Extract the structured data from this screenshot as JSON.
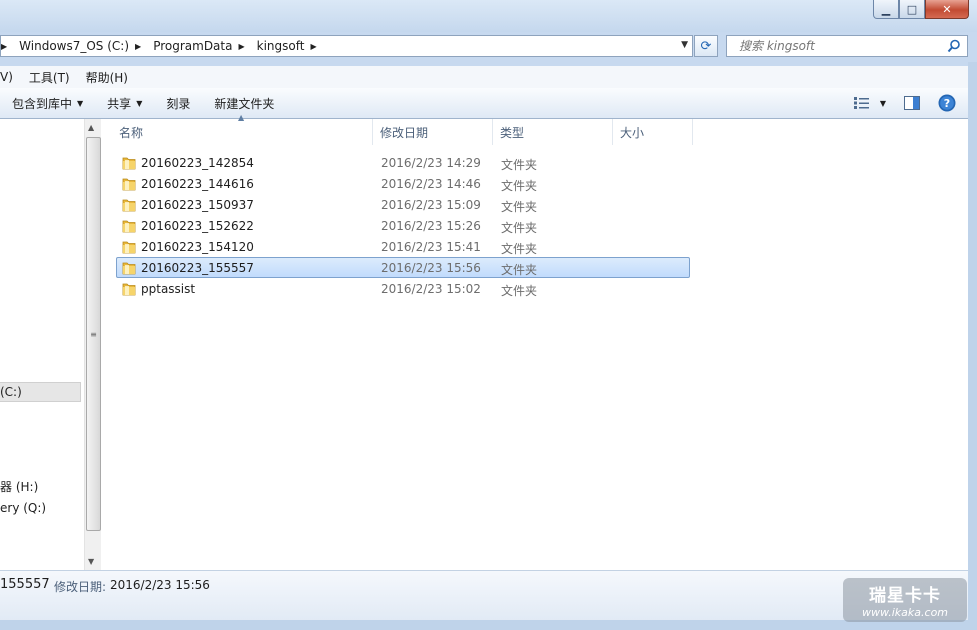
{
  "window": {
    "min_glyph": "▁",
    "max_glyph": "□",
    "close_glyph": "✕"
  },
  "address": {
    "leading": "‹‹",
    "crumbs": [
      "Windows7_OS (C:)",
      "ProgramData",
      "kingsoft"
    ]
  },
  "search": {
    "placeholder": "搜索 kingsoft"
  },
  "menu": {
    "items": [
      "V)",
      "工具(T)",
      "帮助(H)"
    ]
  },
  "toolbar": {
    "include_library": "包含到库中",
    "share": "共享",
    "burn": "刻录",
    "new_folder": "新建文件夹"
  },
  "nav": {
    "drive_c": "(C:)",
    "drive_h": "器 (H:)",
    "drive_q": "ery (Q:)"
  },
  "columns": [
    "名称",
    "修改日期",
    "类型",
    "大小"
  ],
  "files": [
    {
      "name": "20160223_142854",
      "date": "2016/2/23 14:29",
      "type": "文件夹"
    },
    {
      "name": "20160223_144616",
      "date": "2016/2/23 14:46",
      "type": "文件夹"
    },
    {
      "name": "20160223_150937",
      "date": "2016/2/23 15:09",
      "type": "文件夹"
    },
    {
      "name": "20160223_152622",
      "date": "2016/2/23 15:26",
      "type": "文件夹"
    },
    {
      "name": "20160223_154120",
      "date": "2016/2/23 15:41",
      "type": "文件夹"
    },
    {
      "name": "20160223_155557",
      "date": "2016/2/23 15:56",
      "type": "文件夹"
    },
    {
      "name": "pptassist",
      "date": "2016/2/23 15:02",
      "type": "文件夹"
    }
  ],
  "selected_index": 5,
  "details": {
    "name": "155557",
    "date_label": "修改日期:",
    "date_value": "2016/2/23 15:56"
  },
  "watermark": {
    "logo": "瑞星卡卡",
    "url": "www.ikaka.com"
  },
  "colors": {
    "folder": "#e8b73b",
    "selection": "#c1dbfc",
    "accent": "#2466b3"
  }
}
